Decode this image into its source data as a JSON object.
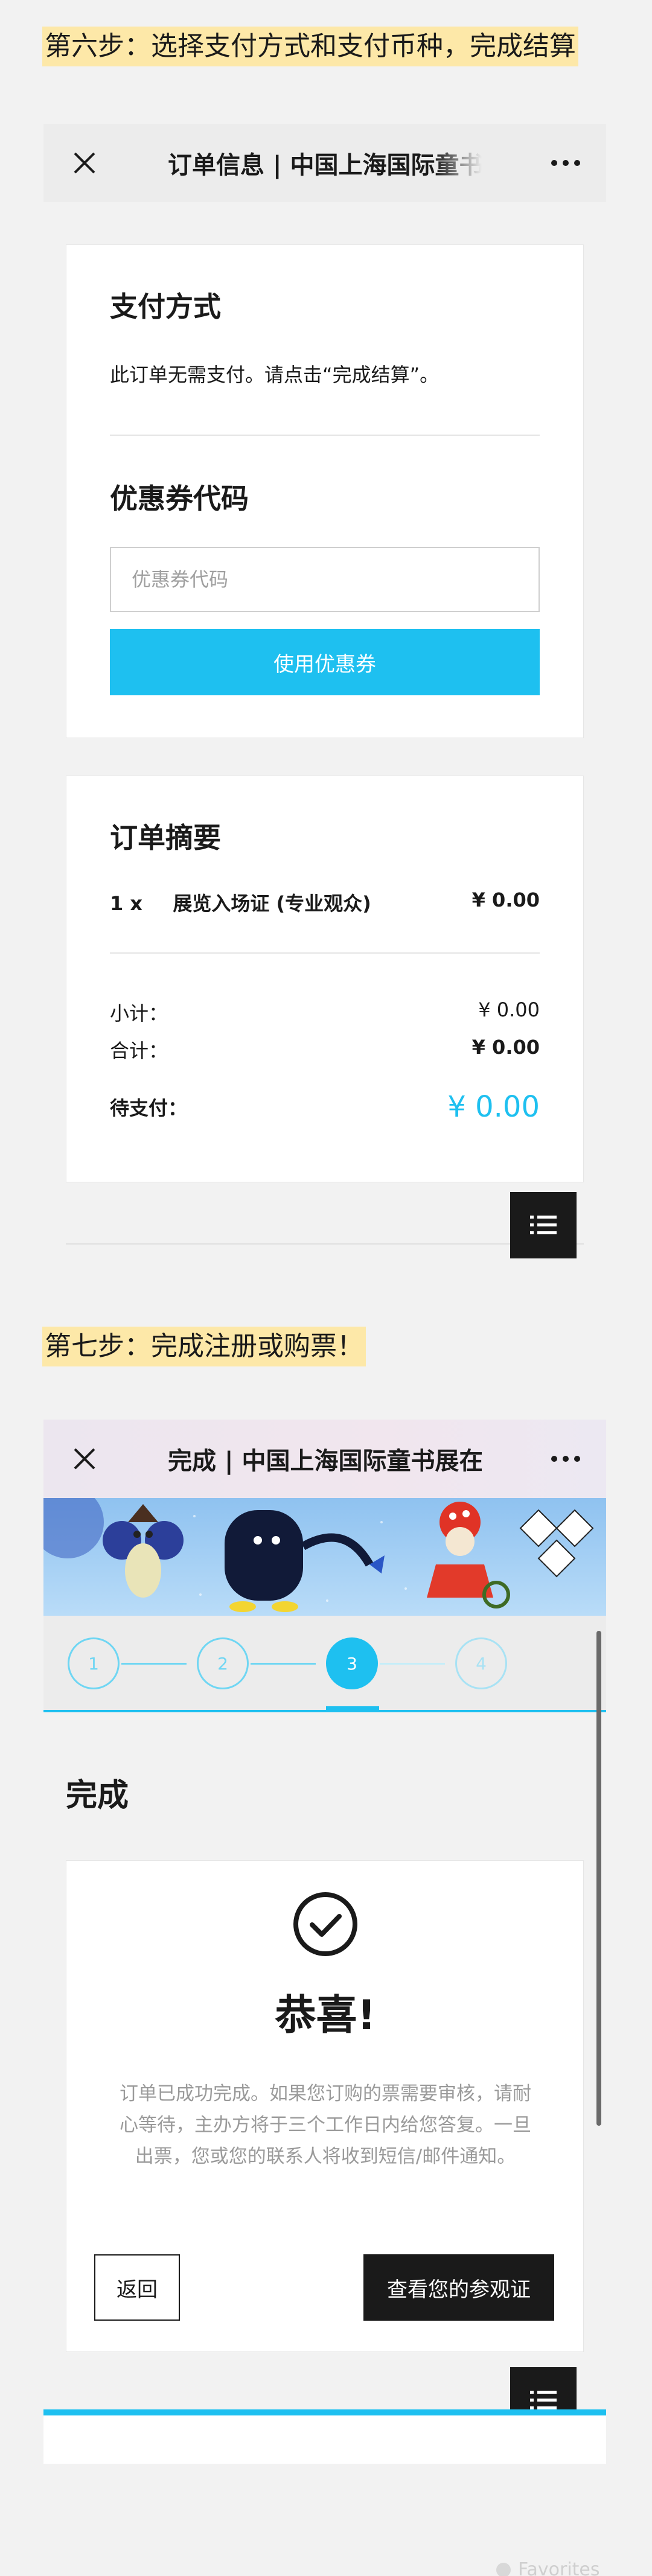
{
  "step6": {
    "label": "第六步：选择支付方式和支付币种，完成结算"
  },
  "payment_screen": {
    "title": "订单信息 | 中国上海国际童书",
    "payment": {
      "heading": "支付方式",
      "note": "此订单无需支付。请点击“完成结算”。"
    },
    "coupon": {
      "heading": "优惠券代码",
      "placeholder": "优惠券代码",
      "button": "使用优惠券"
    },
    "summary": {
      "heading": "订单摘要",
      "item_qty": "1 x",
      "item_name": "展览入场证 (专业观众)",
      "item_price": "¥ 0.00",
      "subtotal_label": "小计：",
      "subtotal_value": "¥ 0.00",
      "total_label": "合计：",
      "total_value": "¥ 0.00",
      "due_label": "待支付：",
      "due_value": "¥ 0.00"
    }
  },
  "step7": {
    "label": "第七步：完成注册或购票！"
  },
  "complete_screen": {
    "title": "完成 | 中国上海国际童书展在",
    "steps": [
      "1",
      "2",
      "3",
      "4"
    ],
    "active_step": 3,
    "heading": "完成",
    "congrats": "恭喜!",
    "message_line1": "订单已成功完成。如果您订购的票需要审核，请耐",
    "message_line2": "心等待，主办方将于三个工作日内给您答复。一旦",
    "message_line3": "出票，您或您的联系人将收到短信/邮件通知。",
    "back_button": "返回",
    "view_button": "查看您的参观证"
  },
  "footer": {
    "favorites": "Favorites"
  },
  "colors": {
    "accent": "#1ec0f0",
    "dark": "#1a1a1a",
    "highlight": "#fde8a8"
  }
}
